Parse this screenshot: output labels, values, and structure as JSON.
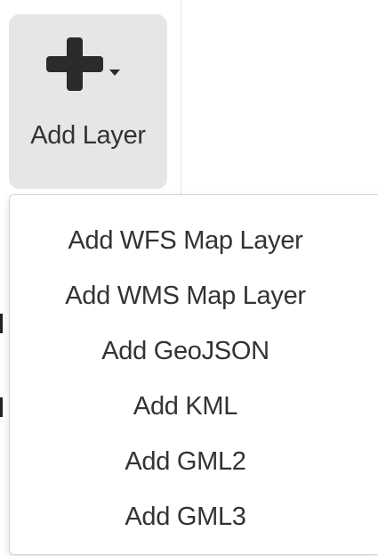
{
  "add_layer_button": {
    "label": "Add Layer",
    "icon": "plus-icon",
    "dropdown_indicator": "caret-down-icon"
  },
  "dropdown": {
    "items": [
      {
        "label": "Add WFS Map Layer"
      },
      {
        "label": "Add WMS Map Layer"
      },
      {
        "label": "Add GeoJSON"
      },
      {
        "label": "Add KML"
      },
      {
        "label": "Add GML2"
      },
      {
        "label": "Add GML3"
      }
    ]
  },
  "colors": {
    "button_background": "#e6e6e6",
    "icon": "#2b2b2b",
    "text": "#333333",
    "menu_border": "#d6d6d6"
  }
}
